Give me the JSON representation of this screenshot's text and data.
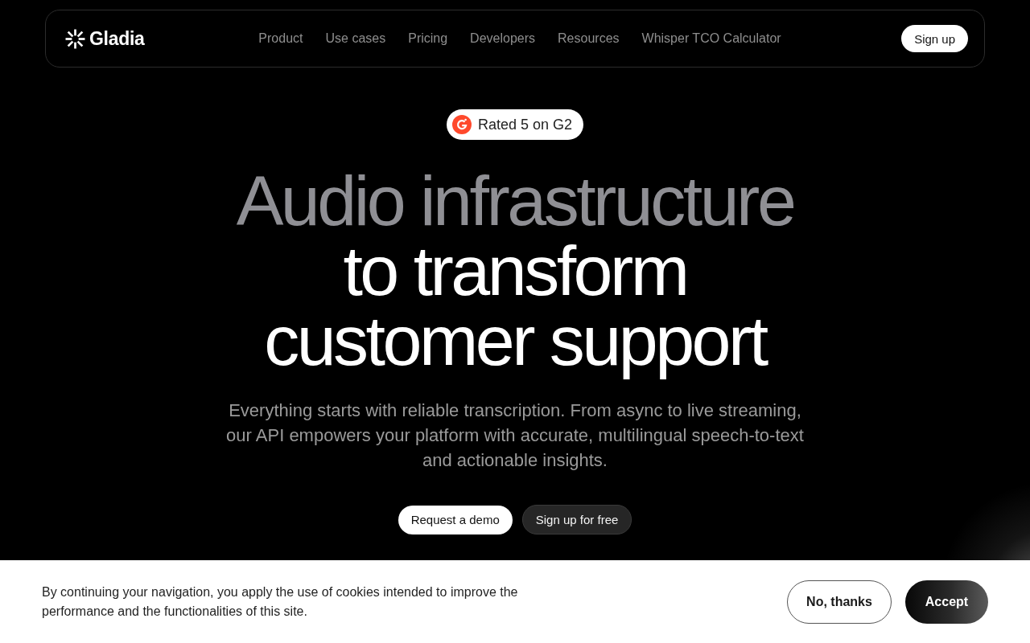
{
  "nav": {
    "logo": "Gladia",
    "links": [
      "Product",
      "Use cases",
      "Pricing",
      "Developers",
      "Resources",
      "Whisper TCO Calculator"
    ],
    "sign_up": "Sign up"
  },
  "hero": {
    "badge": "Rated 5 on G2",
    "headline": {
      "lead": "Audio infrastructure",
      "rest": "to transform customer support"
    },
    "subtitle": "Everything starts with reliable transcription. From async to live streaming, our API empowers your platform with accurate, multilingual speech-to-text and actionable insights.",
    "buttons": [
      {
        "label": "Request a demo",
        "kind": "primary"
      },
      {
        "label": "Sign up for free",
        "kind": "secondary"
      }
    ]
  },
  "cookie_banner": {
    "text": "By continuing your navigation, you apply the use of cookies intended to improve the performance and the functionalities of this site.",
    "buttons": [
      {
        "label": "No, thanks",
        "kind": "outline"
      },
      {
        "label": "Accept",
        "kind": "filled"
      }
    ]
  }
}
